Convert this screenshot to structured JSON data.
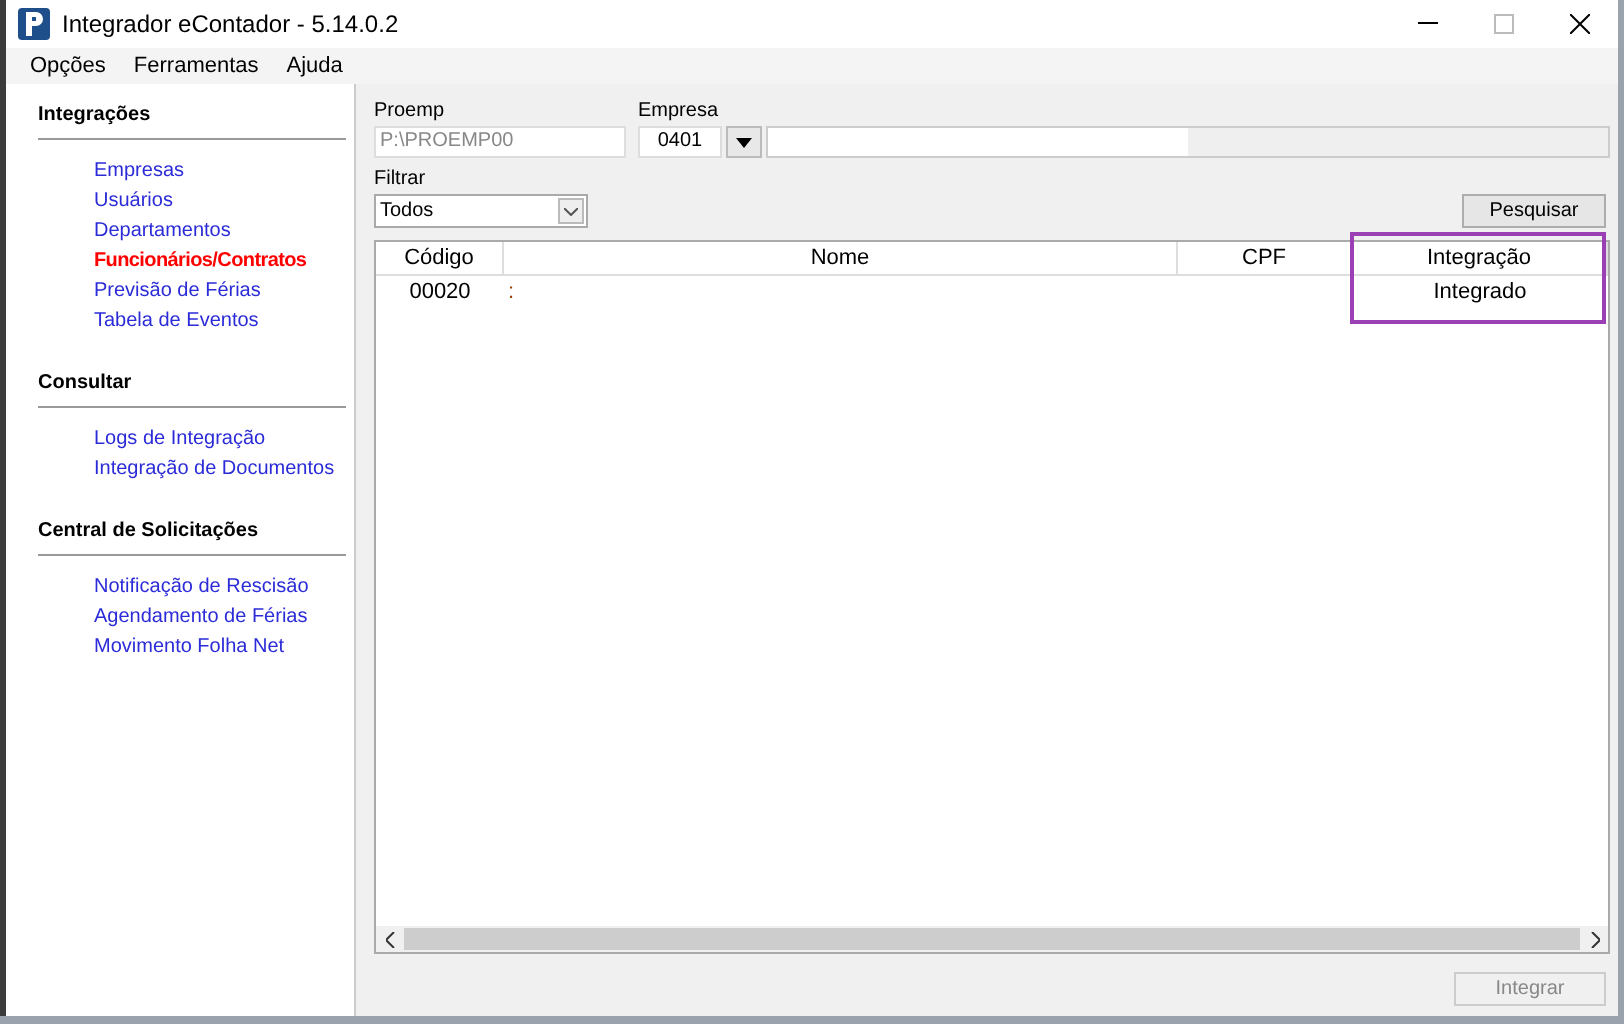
{
  "window": {
    "title": "Integrador eContador - 5.14.0.2"
  },
  "menu": [
    "Opções",
    "Ferramentas",
    "Ajuda"
  ],
  "sidebar": [
    {
      "title": "Integrações",
      "items": [
        {
          "label": "Empresas",
          "selected": false
        },
        {
          "label": "Usuários",
          "selected": false
        },
        {
          "label": "Departamentos",
          "selected": false
        },
        {
          "label": "Funcionários/Contratos",
          "selected": true
        },
        {
          "label": "Previsão de Férias",
          "selected": false
        },
        {
          "label": "Tabela de Eventos",
          "selected": false
        }
      ]
    },
    {
      "title": "Consultar",
      "items": [
        {
          "label": "Logs de Integração",
          "selected": false
        },
        {
          "label": "Integração de Documentos",
          "selected": false
        }
      ]
    },
    {
      "title": "Central de Solicitações",
      "items": [
        {
          "label": "Notificação de Rescisão",
          "selected": false
        },
        {
          "label": "Agendamento de Férias",
          "selected": false
        },
        {
          "label": "Movimento Folha Net",
          "selected": false
        }
      ]
    }
  ],
  "proemp": {
    "label": "Proemp",
    "value": "P:\\PROEMP00"
  },
  "empresa": {
    "label": "Empresa",
    "value": "0401"
  },
  "filtrar": {
    "label": "Filtrar",
    "value": "Todos"
  },
  "search_button": "Pesquisar",
  "table": {
    "columns": [
      "Código",
      "Nome",
      "CPF",
      "Integração"
    ],
    "rows": [
      [
        "00020",
        ":",
        "",
        "Integrado"
      ]
    ]
  },
  "integrate_button": {
    "label": "Integrar",
    "disabled": true
  }
}
